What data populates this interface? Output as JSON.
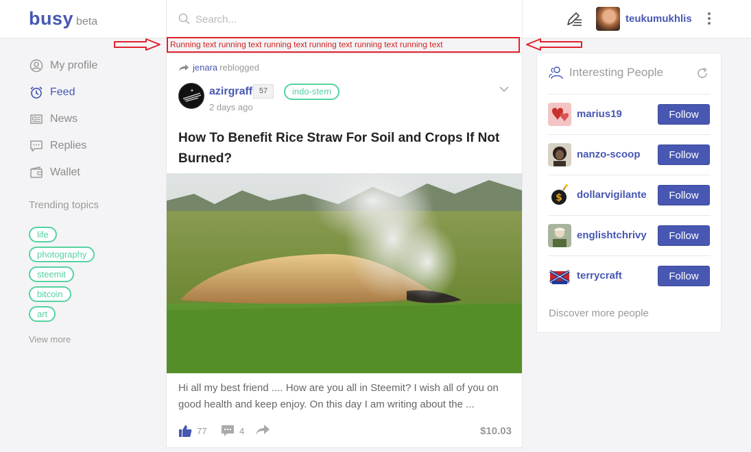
{
  "brand": {
    "name": "busy",
    "tag": "beta"
  },
  "header": {
    "search_placeholder": "Search...",
    "username": "teukumukhlis"
  },
  "annotation": {
    "text": "Running text running text running text running text running text running text"
  },
  "sidebar": {
    "items": [
      {
        "label": "My profile",
        "icon": "user-circle-icon",
        "active": false
      },
      {
        "label": "Feed",
        "icon": "alarm-clock-icon",
        "active": true
      },
      {
        "label": "News",
        "icon": "newspaper-icon",
        "active": false
      },
      {
        "label": "Replies",
        "icon": "chat-bubble-icon",
        "active": false
      },
      {
        "label": "Wallet",
        "icon": "wallet-icon",
        "active": false
      }
    ],
    "trending_title": "Trending topics",
    "topics": [
      "life",
      "photography",
      "steemit",
      "bitcoin",
      "art"
    ],
    "view_more": "View more"
  },
  "post": {
    "reblogged_by": "jenara",
    "reblog_text": "reblogged",
    "author": "azirgraff",
    "reputation": "57",
    "tag": "indo-stem",
    "time": "2 days ago",
    "title": "How To Benefit Rice Straw For Soil and Crops If Not Burned?",
    "body": "Hi all my best friend .... How are you all in Steemit? I wish all of you on good health and keep enjoy. On this day I am writing about the ...",
    "likes": "77",
    "comments": "4",
    "payout": "$10.03"
  },
  "people": {
    "title": "Interesting People",
    "follow_label": "Follow",
    "list": [
      {
        "name": "marius19"
      },
      {
        "name": "nanzo-scoop"
      },
      {
        "name": "dollarvigilante"
      },
      {
        "name": "englishtchrivy"
      },
      {
        "name": "terrycraft"
      }
    ],
    "discover": "Discover more people"
  },
  "colors": {
    "accent": "#4757b2",
    "tag": "#54d2a0",
    "annotation": "#e0202a"
  }
}
